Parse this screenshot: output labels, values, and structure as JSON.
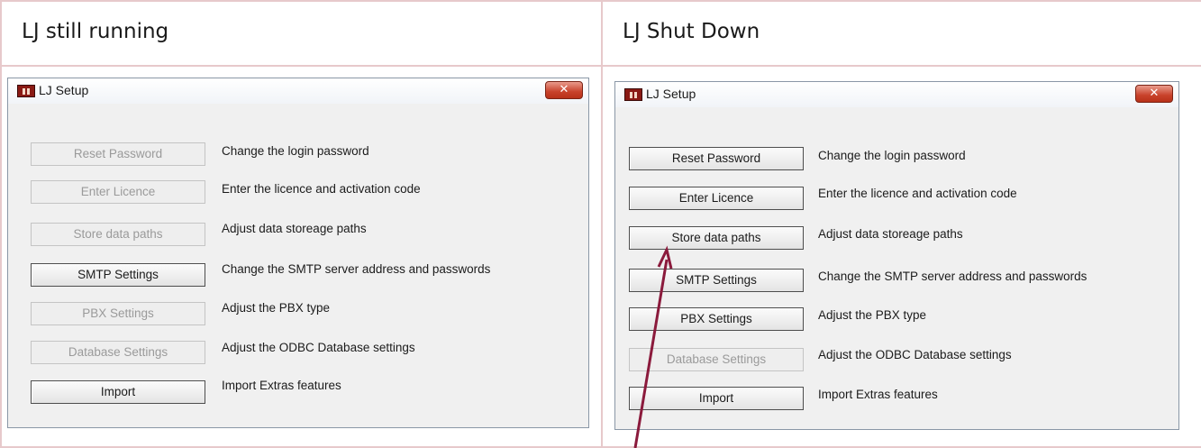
{
  "columns": [
    {
      "heading": "LJ still running"
    },
    {
      "heading": "LJ Shut Down"
    }
  ],
  "dialogs": [
    {
      "title": "LJ Setup",
      "close_glyph": "✕",
      "rows": [
        {
          "button": "Reset Password",
          "enabled": false,
          "description": "Change the login password"
        },
        {
          "button": "Enter Licence",
          "enabled": false,
          "description": "Enter the licence and activation code"
        },
        {
          "button": "Store data paths",
          "enabled": false,
          "description": "Adjust data storeage paths"
        },
        {
          "button": "SMTP Settings",
          "enabled": true,
          "description": "Change the SMTP server address and passwords"
        },
        {
          "button": "PBX Settings",
          "enabled": false,
          "description": "Adjust the PBX type"
        },
        {
          "button": "Database Settings",
          "enabled": false,
          "description": "Adjust the ODBC Database settings"
        },
        {
          "button": "Import",
          "enabled": true,
          "description": "Import Extras features"
        }
      ]
    },
    {
      "title": "LJ Setup",
      "close_glyph": "✕",
      "rows": [
        {
          "button": "Reset Password",
          "enabled": true,
          "description": "Change the login password"
        },
        {
          "button": "Enter Licence",
          "enabled": true,
          "description": "Enter the licence and activation code"
        },
        {
          "button": "Store data paths",
          "enabled": true,
          "description": "Adjust data storeage paths"
        },
        {
          "button": "SMTP Settings",
          "enabled": true,
          "description": "Change the SMTP server address and passwords"
        },
        {
          "button": "PBX Settings",
          "enabled": true,
          "description": "Adjust the PBX type"
        },
        {
          "button": "Database Settings",
          "enabled": false,
          "description": "Adjust the ODBC Database settings"
        },
        {
          "button": "Import",
          "enabled": true,
          "description": "Import Extras features"
        }
      ]
    }
  ],
  "annotation": {
    "color": "#8b1a3c",
    "target": "Store data paths"
  }
}
